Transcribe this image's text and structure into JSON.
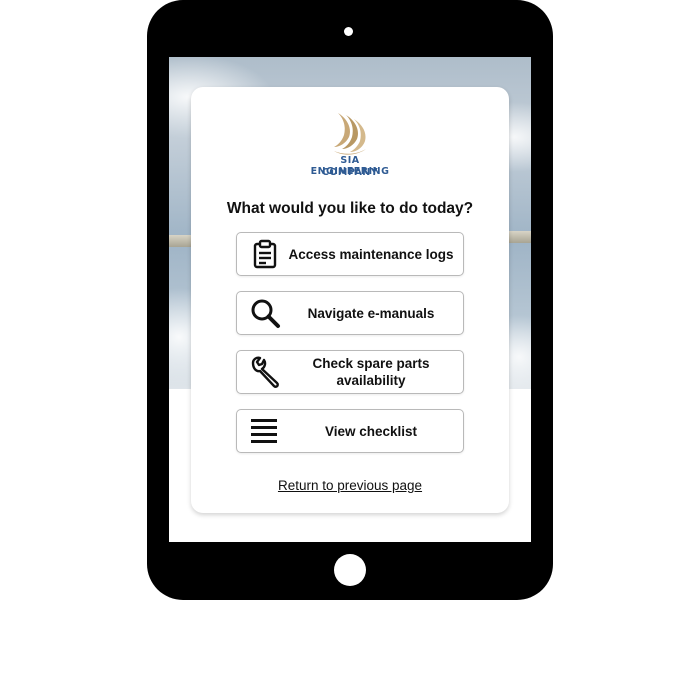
{
  "app": {
    "brand": {
      "line1": "SIA ENGINEERING",
      "line2": "COMPANY",
      "accent": "#2f5b93",
      "mark_color": "#c8a877"
    },
    "prompt": "What would you like to do today?",
    "actions": [
      {
        "label": "Access maintenance logs",
        "icon": "clipboard-icon"
      },
      {
        "label": "Navigate e-manuals",
        "icon": "search-icon"
      },
      {
        "label": "Check spare parts availability",
        "icon": "wrench-icon"
      },
      {
        "label": "View checklist",
        "icon": "list-icon"
      }
    ],
    "return_link": "Return to previous page"
  }
}
